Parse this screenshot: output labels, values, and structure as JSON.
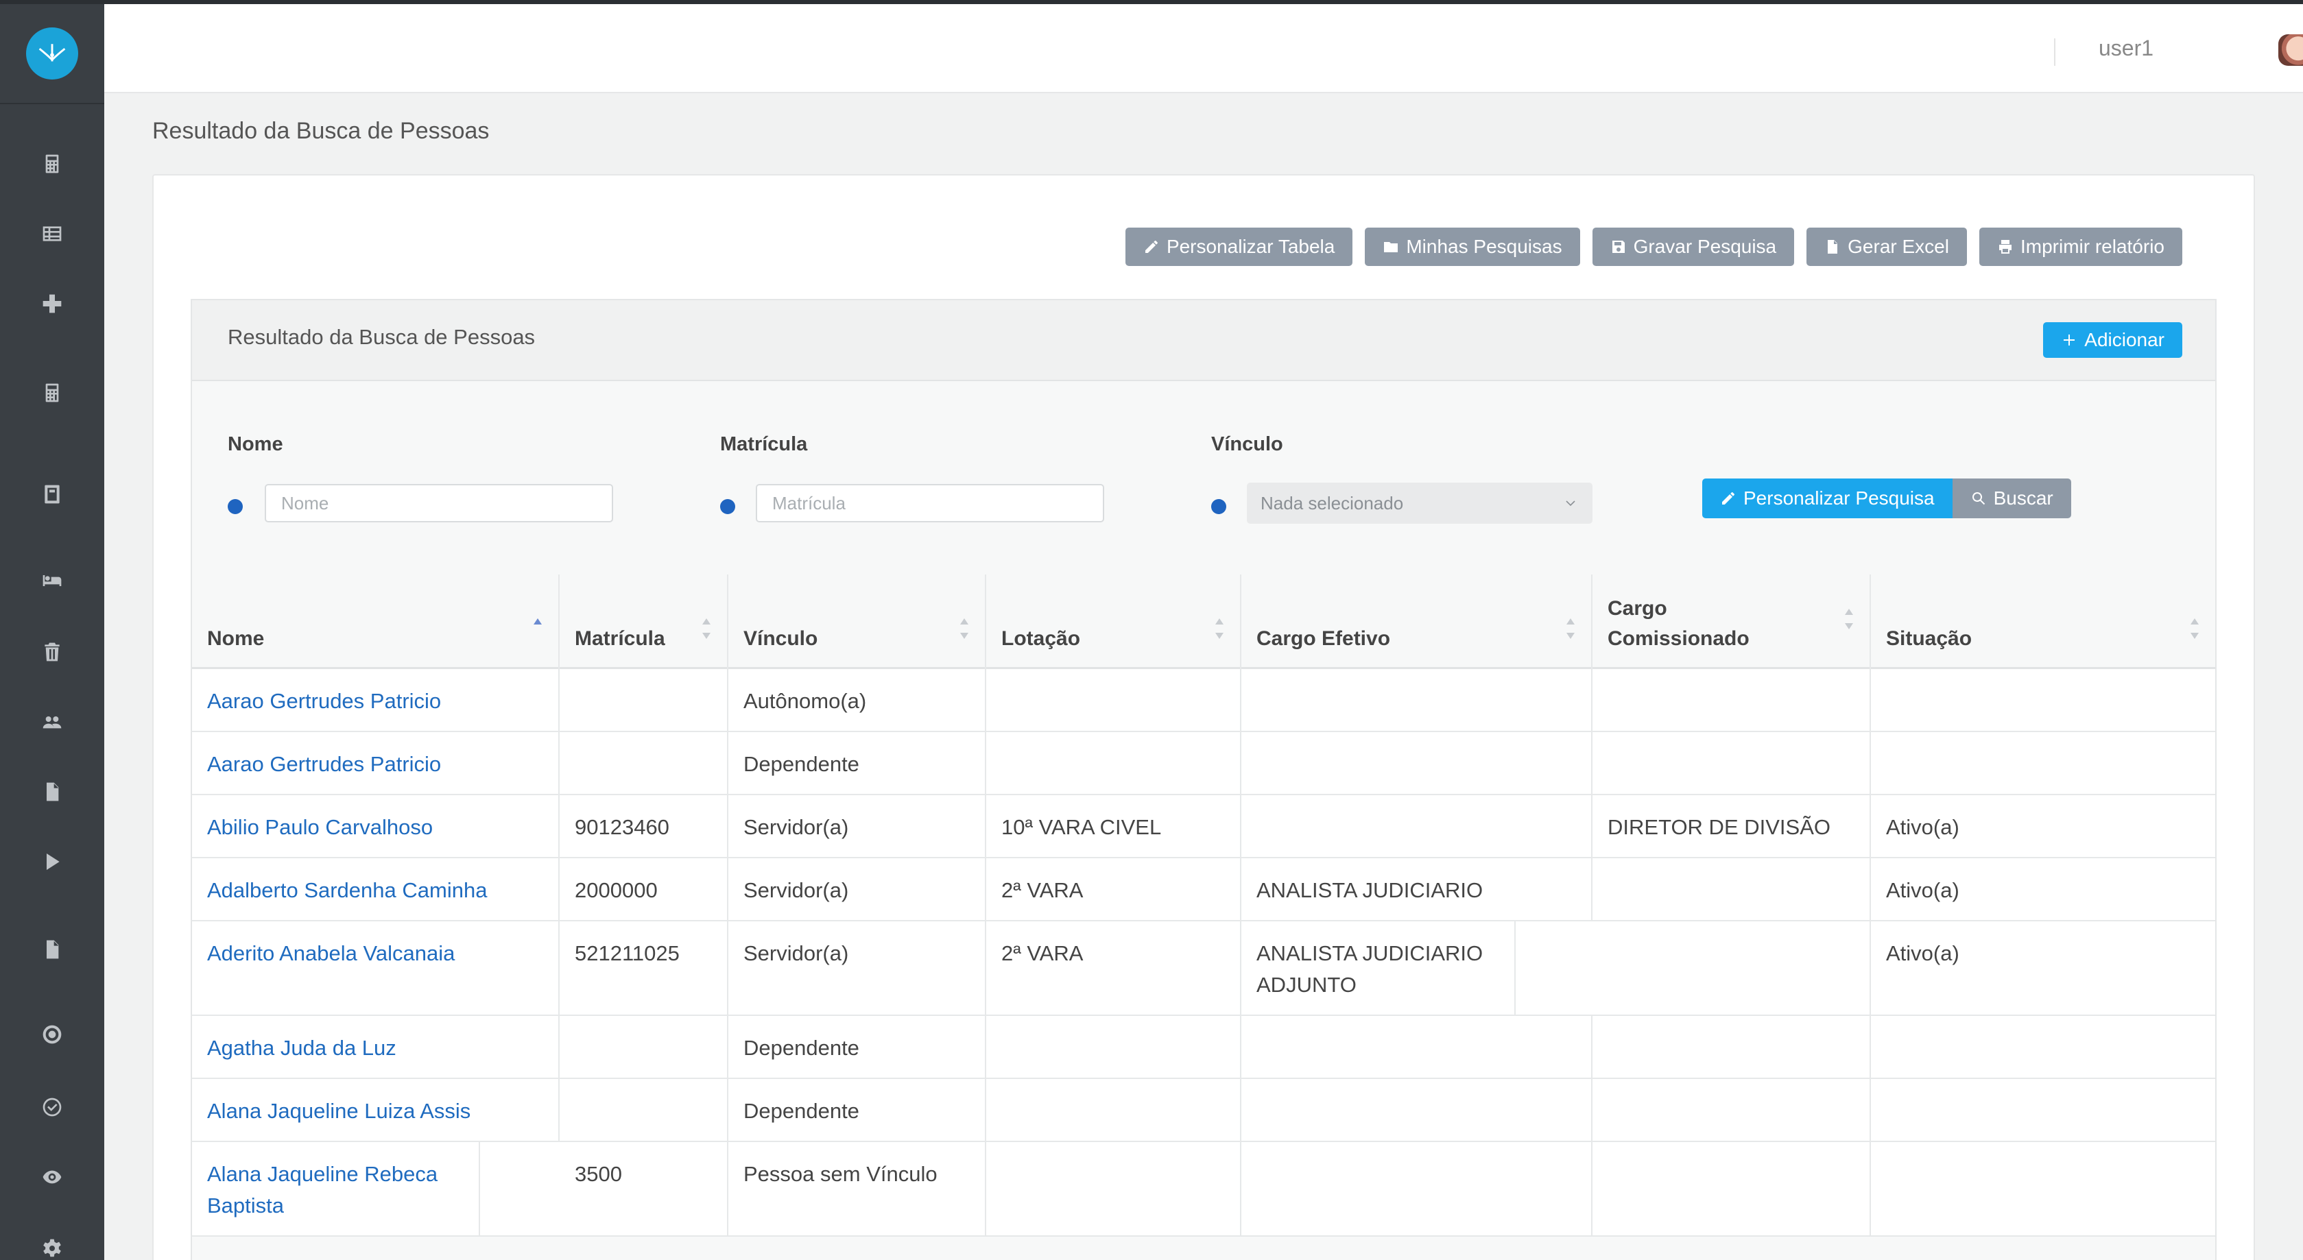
{
  "header": {
    "user_name": "user1"
  },
  "page": {
    "title": "Resultado da Busca de Pessoas"
  },
  "toolbar": {
    "customize_table": "Personalizar Tabela",
    "my_searches": "Minhas Pesquisas",
    "save_search": "Gravar Pesquisa",
    "excel": "Gerar Excel",
    "print": "Imprimir relatório"
  },
  "panel": {
    "title": "Resultado da Busca de Pessoas",
    "add_label": "Adicionar"
  },
  "filters": {
    "name_label": "Nome",
    "name_placeholder": "Nome",
    "matricula_label": "Matrícula",
    "matricula_placeholder": "Matrícula",
    "vinculo_label": "Vínculo",
    "vinculo_selected": "Nada selecionado",
    "customize_search": "Personalizar Pesquisa",
    "search": "Buscar"
  },
  "table": {
    "columns": [
      "Nome",
      "Matrícula",
      "Vínculo",
      "Lotação",
      "Cargo Efetivo",
      "Cargo Comissionado",
      "Situação"
    ],
    "columns_line2": [
      "",
      "",
      "",
      "",
      "",
      "Comissionado",
      ""
    ],
    "rows": [
      [
        "Aarao Gertrudes Patricio",
        "",
        "Autônomo(a)",
        "",
        "",
        "",
        ""
      ],
      [
        "Aarao Gertrudes Patricio",
        "",
        "Dependente",
        "",
        "",
        "",
        ""
      ],
      [
        "Abilio Paulo Carvalhoso",
        "90123460",
        "Servidor(a)",
        "10ª VARA CIVEL",
        "",
        "DIRETOR DE DIVISÃO",
        "Ativo(a)"
      ],
      [
        "Adalberto Sardenha Caminha",
        "2000000",
        "Servidor(a)",
        "2ª VARA",
        "ANALISTA JUDICIARIO",
        "",
        "Ativo(a)"
      ],
      [
        "Aderito Anabela Valcanaia",
        "521211025",
        "Servidor(a)",
        "2ª VARA",
        "ANALISTA JUDICIARIO ADJUNTO",
        "",
        "Ativo(a)"
      ],
      [
        "Agatha Juda da Luz",
        "",
        "Dependente",
        "",
        "",
        "",
        ""
      ],
      [
        "Alana Jaqueline Luiza Assis",
        "",
        "Dependente",
        "",
        "",
        "",
        ""
      ],
      [
        "Alana Jaqueline Rebeca Baptista",
        "3500",
        "Pessoa sem Vínculo",
        "",
        "",
        "",
        ""
      ]
    ]
  },
  "sidebar": {
    "icons": [
      "calculator-icon",
      "table-list-icon",
      "plus-cross-icon",
      "calculator-icon",
      "calculator-alt-icon",
      "bed-icon",
      "trash-icon",
      "users-icon",
      "file-icon",
      "play-icon",
      "file-alt-icon",
      "target-icon",
      "check-circle-icon",
      "eye-icon",
      "gear-icon"
    ]
  },
  "colors": {
    "sidebar": "#3a3f44",
    "primary": "#1ba6ec",
    "secondary": "#8e99a6",
    "link": "#1f6bbf"
  }
}
